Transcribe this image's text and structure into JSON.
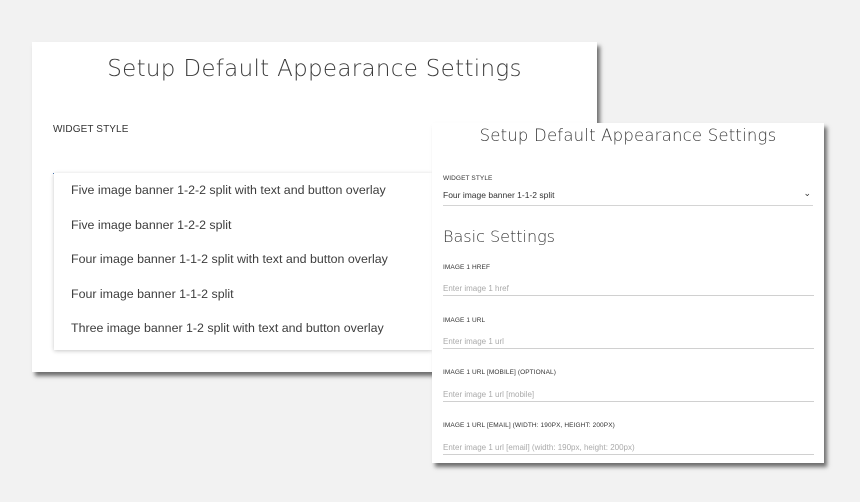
{
  "back_panel": {
    "title": "Setup Default Appearance Settings",
    "widget_style_label": "WIDGET STYLE",
    "dropdown_options": [
      "Five image banner 1-2-2 split with text and button overlay",
      "Five image banner 1-2-2 split",
      "Four image banner 1-1-2 split with text and button overlay",
      "Four image banner 1-1-2 split",
      "Three image banner 1-2 split with text and button overlay"
    ]
  },
  "front_panel": {
    "title": "Setup Default Appearance Settings",
    "widget_style_label": "WIDGET STYLE",
    "widget_style_value": "Four image banner 1-1-2 split",
    "chevron_icon": "chevron-down-icon",
    "basic_settings_heading": "Basic Settings",
    "fields": [
      {
        "label": "IMAGE 1 HREF",
        "placeholder": "Enter image 1 href"
      },
      {
        "label": "IMAGE 1 URL",
        "placeholder": "Enter image 1 url"
      },
      {
        "label": "IMAGE 1 URL [MOBILE] (OPTIONAL)",
        "placeholder": "Enter image 1 url [mobile]"
      },
      {
        "label": "IMAGE 1 URL [EMAIL] (WIDTH: 190PX, HEIGHT: 200PX)",
        "placeholder": "Enter image 1 url [email] (width: 190px, height: 200px)"
      }
    ]
  },
  "colors": {
    "background": "#f2f2f2",
    "panel": "#ffffff",
    "focus_underline": "#4a78b5",
    "text": "#3a3a3a",
    "placeholder": "#aaaaaa"
  }
}
